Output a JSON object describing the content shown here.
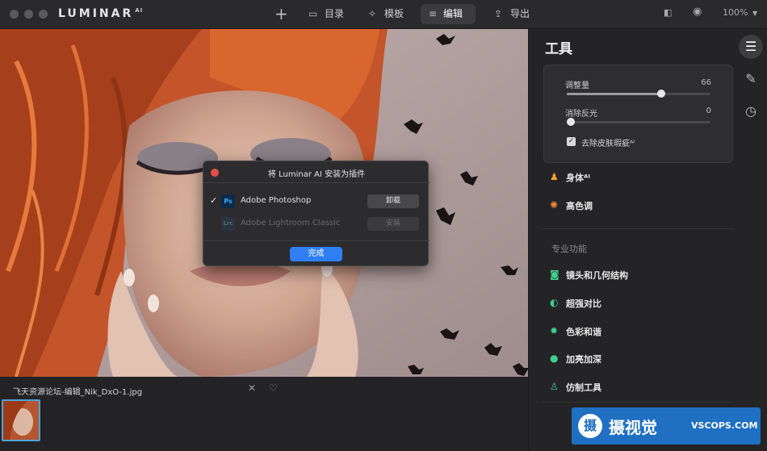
{
  "window": {
    "app_name": "LUMINAR",
    "app_suffix": "AI"
  },
  "nav": {
    "catalog": "目录",
    "templates": "模板",
    "edit": "编辑",
    "export": "导出"
  },
  "toolbar_right": {
    "zoom": "100%"
  },
  "filmstrip": {
    "filename": "飞天资源论坛-编辑_Nik_DxO-1.jpg"
  },
  "panel": {
    "title": "工具",
    "sliders": [
      {
        "label": "调整量",
        "value": "66",
        "level": 0.66
      },
      {
        "label": "消除反光",
        "value": "0",
        "level": 0.0
      }
    ],
    "checkbox": {
      "label": "去除皮肤瑕疵ᴬᴵ",
      "checked": true
    },
    "tools_top": [
      {
        "label": "身体ᴬᴵ",
        "icon": "person-icon",
        "color": "#f4a62a"
      },
      {
        "label": "高色调",
        "icon": "sun-icon",
        "color": "#f28a3c"
      }
    ],
    "section_label": "专业功能",
    "tools_pro": [
      {
        "label": "镜头和几何结构",
        "icon": "camera-icon",
        "color": "#3ecf8e"
      },
      {
        "label": "超强对比",
        "icon": "contrast-icon",
        "color": "#3ecf8e"
      },
      {
        "label": "色彩和谐",
        "icon": "gear-icon",
        "color": "#3ecf8e"
      },
      {
        "label": "加亮加深",
        "icon": "drop-icon",
        "color": "#3ecf8e"
      },
      {
        "label": "仿制工具",
        "icon": "stamp-icon",
        "color": "#3ecf8e"
      }
    ]
  },
  "dialog": {
    "title": "将 Luminar AI 安装为插件",
    "rows": [
      {
        "badge": "Ps",
        "name": "Adobe Photoshop",
        "button": "卸载",
        "enabled": true
      },
      {
        "badge": "Lrc",
        "name": "Adobe Lightroom Classic",
        "button": "安装",
        "enabled": false
      }
    ],
    "done": "完成"
  },
  "watermark": {
    "badge": "摄",
    "cn": "摄视觉",
    "en": "VSCOPS.COM"
  }
}
